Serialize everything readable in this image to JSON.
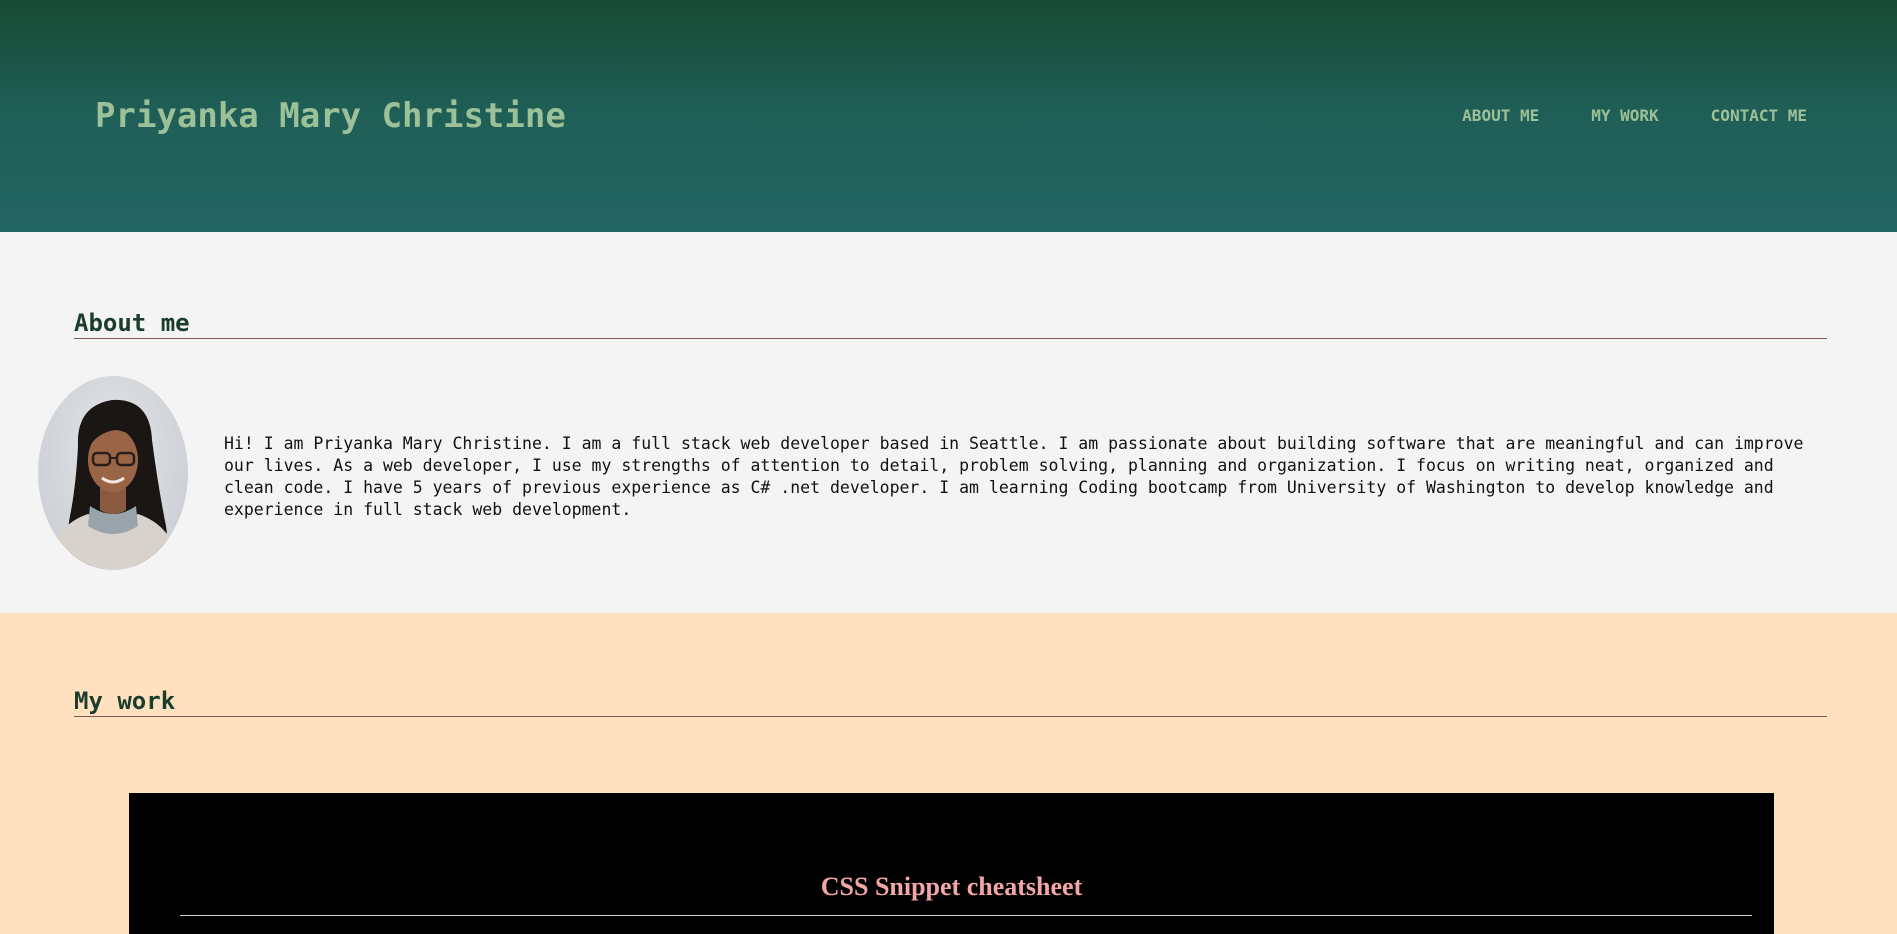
{
  "header": {
    "title": "Priyanka Mary Christine",
    "nav": [
      {
        "label": "ABOUT ME"
      },
      {
        "label": "MY WORK"
      },
      {
        "label": "CONTACT ME"
      }
    ]
  },
  "about": {
    "heading": "About me",
    "avatar_icon": "profile-photo",
    "bio": "Hi! I am Priyanka Mary Christine. I am a full stack web developer based in Seattle. I am passionate about building software that are meaningful and can improve our lives. As a web developer, I use my strengths of attention to detail, problem solving, planning and organization. I focus on writing neat, organized and clean code. I have 5 years of previous experience as C# .net developer. I am learning Coding bootcamp from University of Washington to develop knowledge and experience in full stack web development."
  },
  "work": {
    "heading": "My work",
    "projects": [
      {
        "title": "CSS Snippet cheatsheet"
      }
    ]
  },
  "colors": {
    "header_top": "#174a33",
    "header_bottom": "#246663",
    "title_text": "#9cc097",
    "about_bg": "#f4f4f4",
    "work_bg": "#ffe1c0",
    "heading_text": "#1b3d2c",
    "project_title": "#f2a6a6"
  }
}
